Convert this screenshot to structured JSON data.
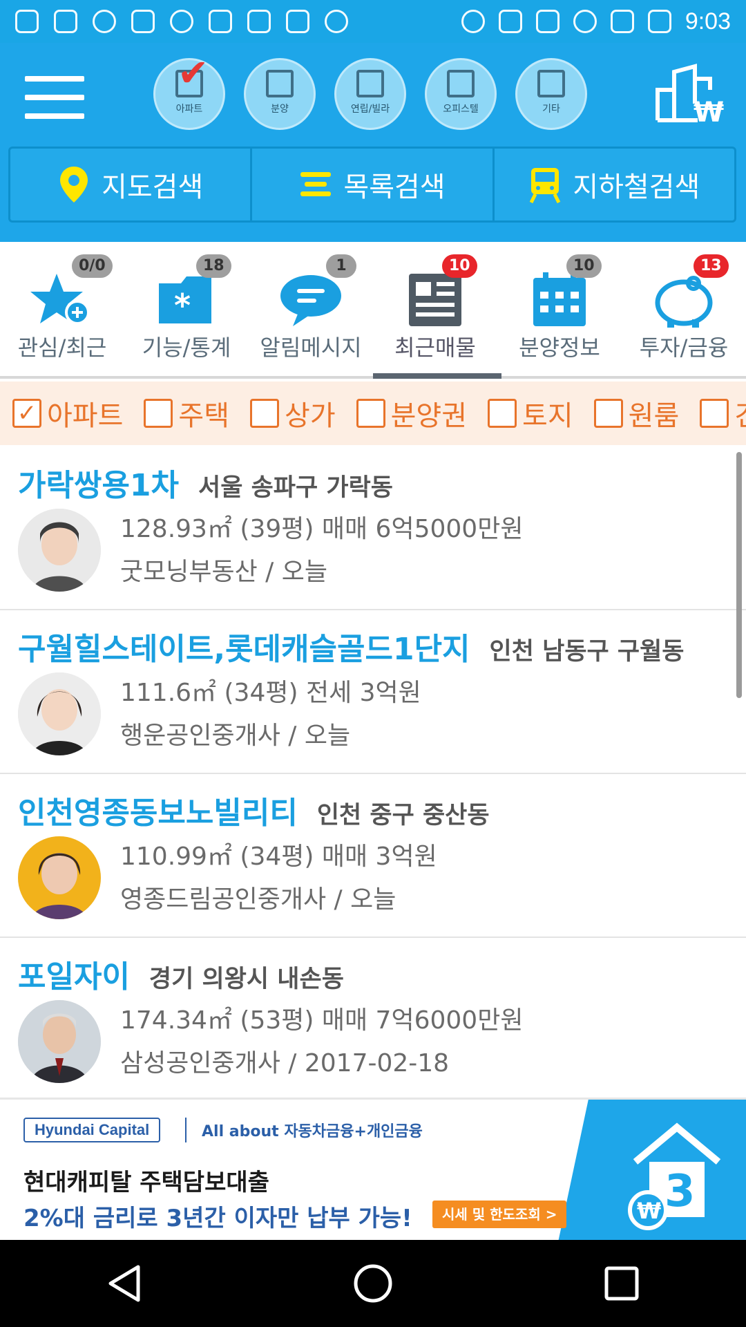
{
  "status_bar": {
    "time": "9:03"
  },
  "header": {
    "property_types": [
      {
        "label": "아파트",
        "checked": true
      },
      {
        "label": "분양",
        "checked": false
      },
      {
        "label": "연립/빌라",
        "checked": false
      },
      {
        "label": "오피스텔",
        "checked": false
      },
      {
        "label": "기타",
        "checked": false
      }
    ],
    "search_tabs": [
      "지도검색",
      "목록검색",
      "지하철검색"
    ]
  },
  "features": [
    {
      "label": "관심/최근",
      "badge": "0/0",
      "badge_style": "gray",
      "icon": "star-plus-icon"
    },
    {
      "label": "기능/통계",
      "badge": "18",
      "badge_style": "gray",
      "icon": "folder-gear-icon"
    },
    {
      "label": "알림메시지",
      "badge": "1",
      "badge_style": "gray",
      "icon": "chat-bubble-icon"
    },
    {
      "label": "최근매물",
      "badge": "10",
      "badge_style": "red",
      "icon": "newspaper-icon",
      "active": true
    },
    {
      "label": "분양정보",
      "badge": "10",
      "badge_style": "gray",
      "icon": "calendar-icon"
    },
    {
      "label": "투자/금융",
      "badge": "13",
      "badge_style": "red",
      "icon": "piggy-bank-icon"
    }
  ],
  "filters": [
    {
      "label": "아파트",
      "checked": true
    },
    {
      "label": "주택",
      "checked": false
    },
    {
      "label": "상가",
      "checked": false
    },
    {
      "label": "분양권",
      "checked": false
    },
    {
      "label": "토지",
      "checked": false
    },
    {
      "label": "원룸",
      "checked": false
    },
    {
      "label": "건",
      "checked": false
    }
  ],
  "listings": [
    {
      "name": "가락쌍용1차",
      "location": "서울 송파구 가락동",
      "detail": "128.93㎡ (39평) 매매 6억5000만원",
      "agent": "굿모닝부동산 / 오늘"
    },
    {
      "name": "구월힐스테이트,롯데캐슬골드1단지",
      "location": "인천 남동구 구월동",
      "detail": "111.6㎡ (34평) 전세 3억원",
      "agent": "행운공인중개사 / 오늘"
    },
    {
      "name": "인천영종동보노빌리티",
      "location": "인천 중구 중산동",
      "detail": "110.99㎡ (34평) 매매 3억원",
      "agent": "영종드림공인중개사 / 오늘"
    },
    {
      "name": "포일자이",
      "location": "경기 의왕시 내손동",
      "detail": "174.34㎡ (53평) 매매 7억6000만원",
      "agent": "삼성공인중개사 / 2017-02-18"
    }
  ],
  "ad": {
    "brand": "Hyundai Capital",
    "tagline": "All about 자동차금융+개인금융",
    "line1": "현대캐피탈 주택담보대출",
    "line2": "2%대 금리로 3년간 이자만 납부 가능!",
    "cta": "시세 및 한도조회 >",
    "badge_number": "3"
  },
  "colors": {
    "primary": "#1ea6e9",
    "accent_orange": "#e8742b",
    "badge_red": "#e8262b",
    "listing_title": "#1a9fe0"
  }
}
